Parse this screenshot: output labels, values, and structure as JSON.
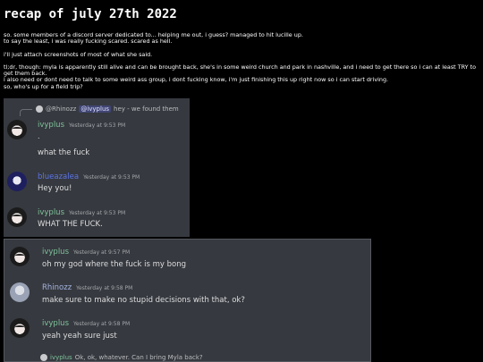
{
  "post": {
    "title": "recap of july 27th 2022",
    "paragraphs": [
      "so. some members of a discord server dedicated to... helping me out, i guess? managed to hit lucille up.",
      "to say the least, i was really fucking scared. scared as hell.",
      "i'll just attach screenshots of most of what she said.",
      "tl;dr, though: myla is apparently still alive and can be brought back, she's in some weird church and park in nashville, and i need to get there so i can at least TRY to get them back.",
      "i also need or dont need to talk to some weird ass group, i dont fucking know, i'm just finishing this up right now so i can start driving.",
      "so, who's up for a field trip?"
    ]
  },
  "screenshot1": {
    "reply": {
      "author": "@Rhinozz",
      "mention": "@ivyplus",
      "text": "hey - we found them"
    },
    "messages": [
      {
        "author": "ivyplus",
        "time": "Yesterday at 9:53 PM",
        "lines": [
          ".",
          "what the fuck"
        ]
      },
      {
        "author": "blueazalea",
        "time": "Yesterday at 9:53 PM",
        "lines": [
          "Hey you!"
        ]
      },
      {
        "author": "ivyplus",
        "time": "Yesterday at 9:53 PM",
        "lines": [
          "WHAT THE FUCK."
        ]
      }
    ]
  },
  "screenshot2": {
    "messages": [
      {
        "author": "ivyplus",
        "time": "Yesterday at 9:57 PM",
        "lines": [
          "oh my god where the fuck is my bong"
        ]
      },
      {
        "author": "Rhinozz",
        "time": "Yesterday at 9:58 PM",
        "lines": [
          "make sure to make no stupid decisions with that, ok?"
        ]
      },
      {
        "author": "ivyplus",
        "time": "Yesterday at 9:58 PM",
        "lines": [
          "yeah yeah sure just"
        ]
      }
    ],
    "cut_reply": {
      "author": "ivyplus",
      "text": "Ok, ok, whatever. Can I bring Myla back?"
    }
  },
  "colors": {
    "background": "#000000",
    "discord_bg": "#36393f",
    "ivyplus_name": "#7ec29b",
    "blueazalea_name": "#5b74e5",
    "rhinozz_name": "#a4b3e0"
  }
}
